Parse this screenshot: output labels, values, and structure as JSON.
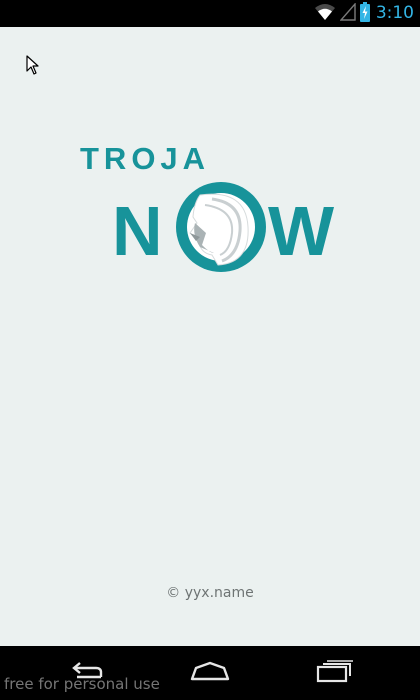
{
  "status_bar": {
    "time": "3:10",
    "icons": [
      "wifi-icon",
      "signal-icon",
      "battery-charging-icon"
    ],
    "time_color": "#33b5e5"
  },
  "splash": {
    "logo_word_top": "TROJA",
    "logo_word_bottom_left": "N",
    "logo_word_bottom_right": "W",
    "brand_color": "#17939a",
    "background_color": "#ebf1f0",
    "copyright": "© yyx.name"
  },
  "nav_bar": {
    "buttons": [
      "back-icon",
      "home-icon",
      "recent-apps-icon"
    ]
  },
  "watermark": "free for personal use"
}
